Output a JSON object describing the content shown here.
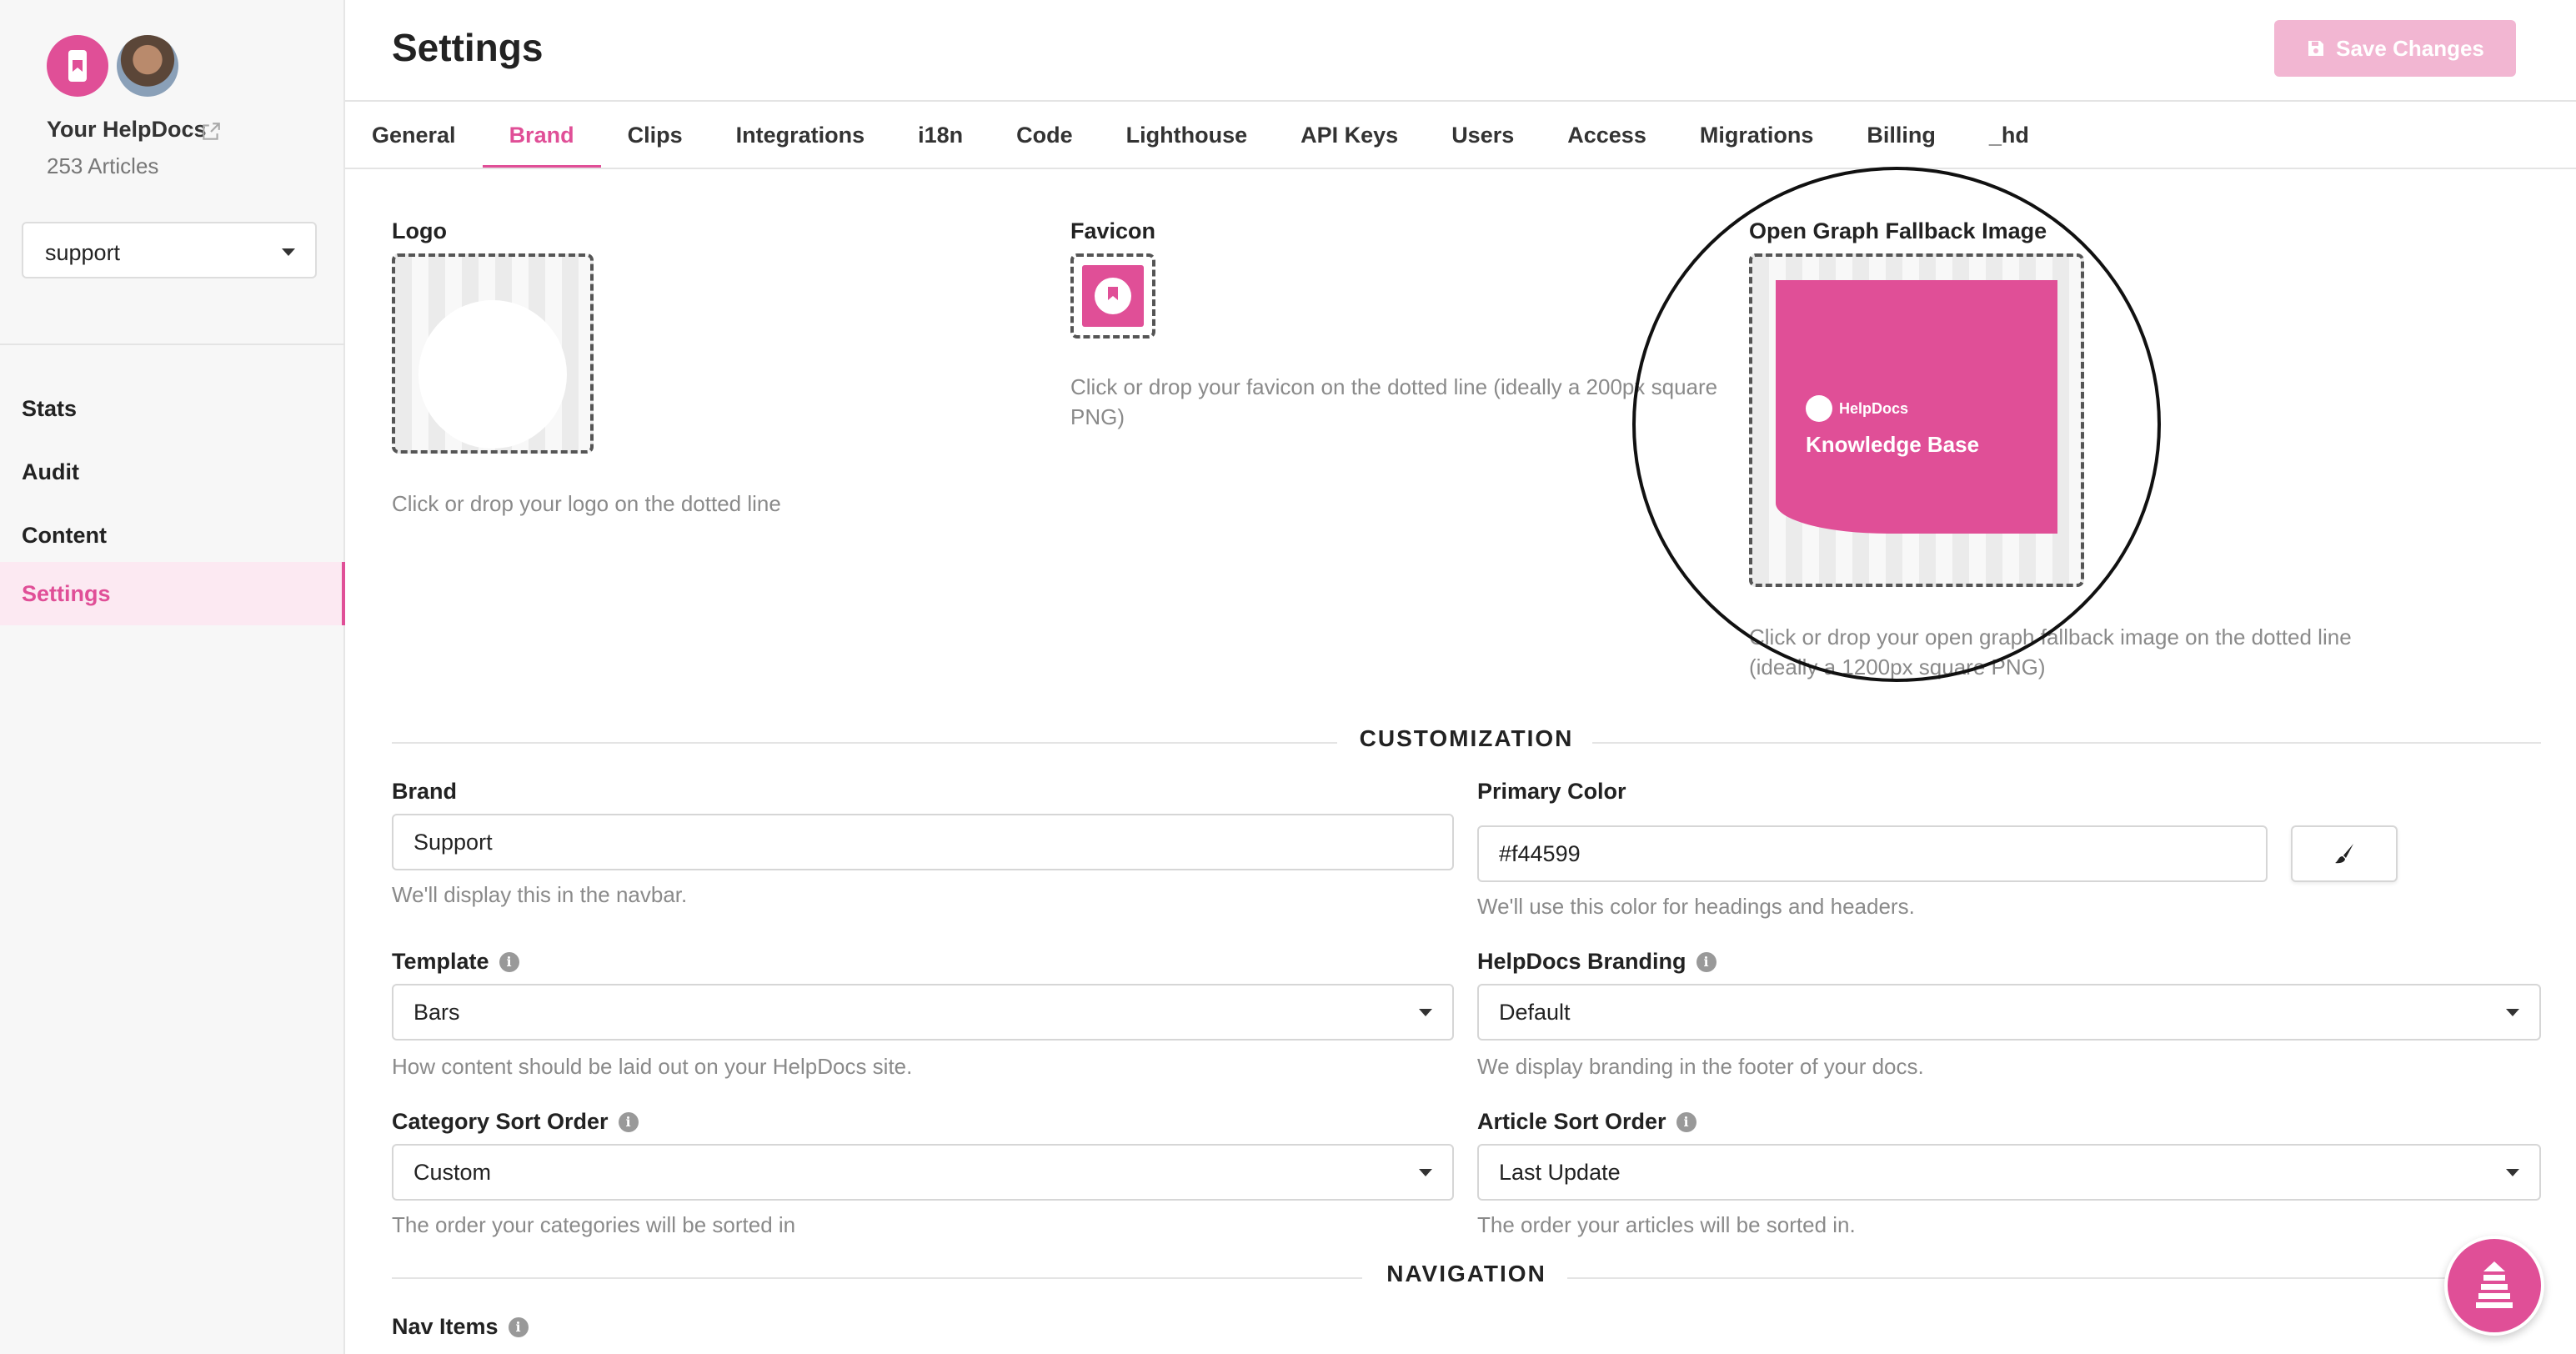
{
  "sidebar": {
    "site_name": "Your HelpDocs",
    "article_count": "253 Articles",
    "kb_select_value": "support",
    "nav": [
      "Stats",
      "Audit",
      "Content",
      "Settings"
    ],
    "active_nav": "Settings"
  },
  "header": {
    "title": "Settings",
    "save_label": "Save Changes"
  },
  "tabs": [
    "General",
    "Brand",
    "Clips",
    "Integrations",
    "i18n",
    "Code",
    "Lighthouse",
    "API Keys",
    "Users",
    "Access",
    "Migrations",
    "Billing",
    "_hd"
  ],
  "active_tab": "Brand",
  "uploads": {
    "logo": {
      "label": "Logo",
      "help": "Click or drop your logo on the dotted line"
    },
    "favicon": {
      "label": "Favicon",
      "help": "Click or drop your favicon on the dotted line (ideally a 200px square PNG)"
    },
    "og": {
      "label": "Open Graph Fallback Image",
      "help": "Click or drop your open graph fallback image on the dotted line (ideally a 1200px square PNG)",
      "card_brand": "HelpDocs",
      "card_title": "Knowledge Base"
    }
  },
  "customization": {
    "heading": "CUSTOMIZATION",
    "brand": {
      "label": "Brand",
      "value": "Support",
      "help": "We'll display this in the navbar."
    },
    "primary_color": {
      "label": "Primary Color",
      "value": "#f44599",
      "help": "We'll use this color for headings and headers."
    },
    "template": {
      "label": "Template",
      "value": "Bars",
      "help": "How content should be laid out on your HelpDocs site."
    },
    "branding": {
      "label": "HelpDocs Branding",
      "value": "Default",
      "help": "We display branding in the footer of your docs."
    },
    "category_sort": {
      "label": "Category Sort Order",
      "value": "Custom",
      "help": "The order your categories will be sorted in"
    },
    "article_sort": {
      "label": "Article Sort Order",
      "value": "Last Update",
      "help": "The order your articles will be sorted in."
    }
  },
  "navigation": {
    "heading": "NAVIGATION",
    "nav_items_label": "Nav Items"
  },
  "colors": {
    "accent": "#e04f97",
    "accent_light": "#f2b6d2"
  },
  "icons": [
    "helpdocs-logo-icon",
    "external-link-icon",
    "chevron-down-icon",
    "save-icon",
    "info-icon",
    "paintbrush-icon",
    "chat-widget-icon"
  ]
}
